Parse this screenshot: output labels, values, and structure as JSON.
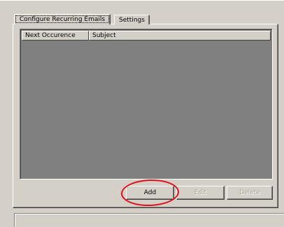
{
  "tabs": [
    {
      "label": "Configure Recurring Emails",
      "active": true
    },
    {
      "label": "Settings",
      "active": false
    }
  ],
  "list": {
    "columns": [
      "Next Occurence",
      "Subject"
    ],
    "rows": []
  },
  "buttons": {
    "add": "Add",
    "edit": "Edit",
    "delete": "Delete"
  },
  "colors": {
    "face": "#d4d0c8",
    "list_background": "#808080",
    "highlight": "#e0101a"
  }
}
